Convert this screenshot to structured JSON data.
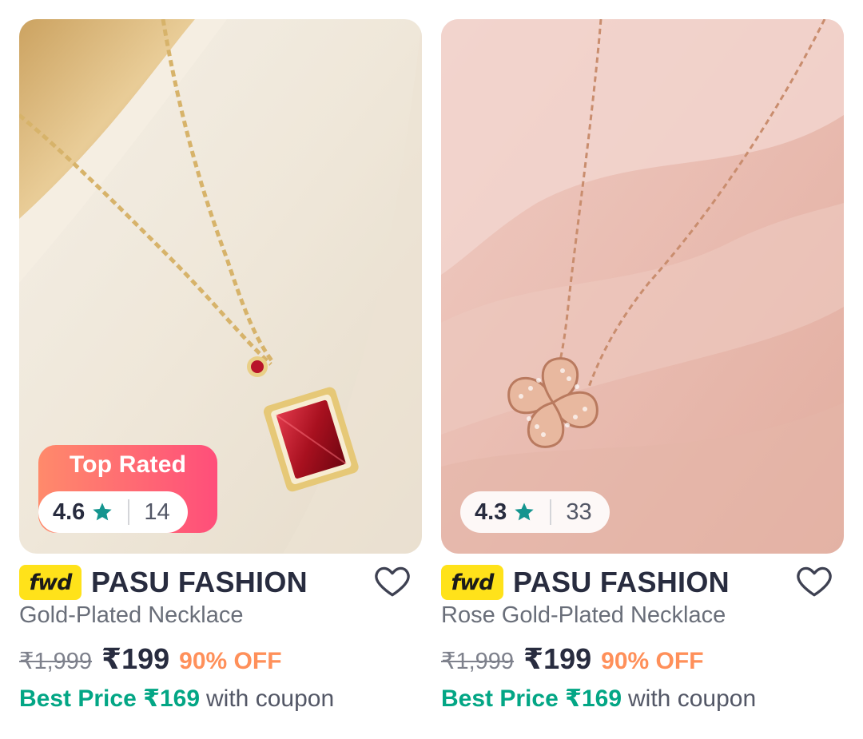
{
  "products": [
    {
      "badge": "Top Rated",
      "rating": "4.6",
      "reviews": "14",
      "brand_tag": "fwd",
      "brand": "PASU FASHION",
      "name": "Gold-Plated Necklace",
      "mrp": "₹1,999",
      "price": "₹199",
      "discount": "90% OFF",
      "best_price": "Best Price ₹169",
      "best_suffix": "with coupon"
    },
    {
      "rating": "4.3",
      "reviews": "33",
      "brand_tag": "fwd",
      "brand": "PASU FASHION",
      "name": "Rose Gold-Plated Necklace",
      "mrp": "₹1,999",
      "price": "₹199",
      "discount": "90% OFF",
      "best_price": "Best Price ₹169",
      "best_suffix": "with coupon"
    }
  ],
  "colors": {
    "accent_green": "#03a685",
    "discount_orange": "#ff905a",
    "star_teal": "#14958f",
    "fwd_yellow": "#ffe21a"
  },
  "icons": [
    "star-icon",
    "heart-icon",
    "fwd-logo"
  ]
}
